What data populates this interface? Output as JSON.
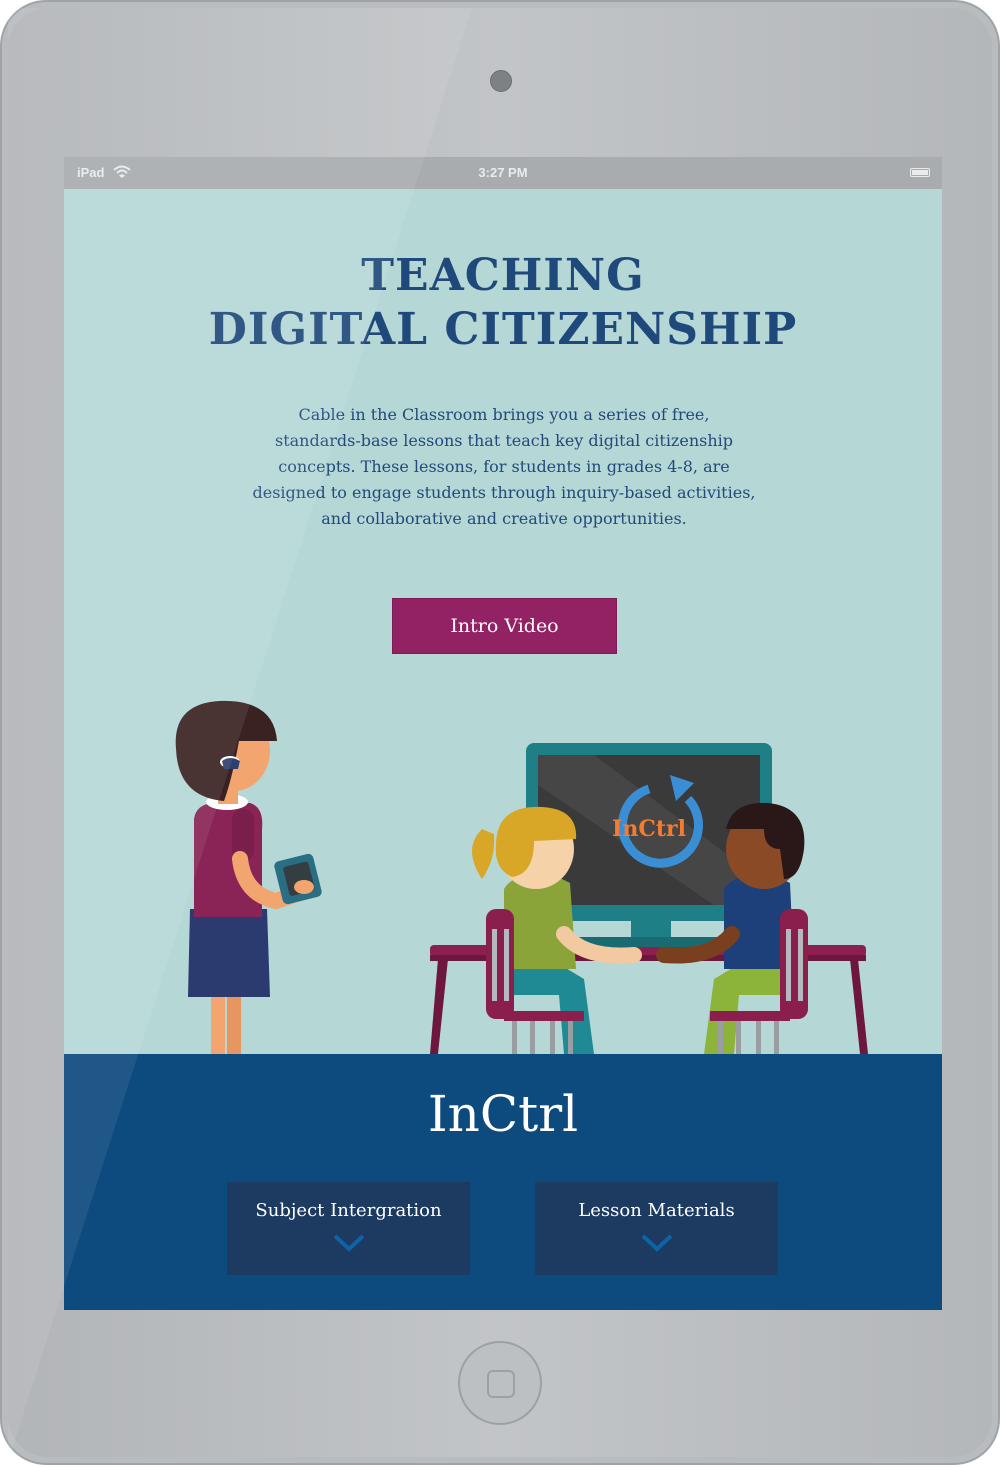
{
  "status_bar": {
    "device": "iPad",
    "time": "3:27 PM"
  },
  "hero": {
    "title_line1": "TEACHING",
    "title_line2": "DIGITAL CITIZENSHIP",
    "intro_lines": [
      "Cable in the Classroom brings you a series of free,",
      "standards-base lessons that teach key digital citizenship",
      "concepts. These lessons, for students in grades 4-8, are",
      "designed to engage  students through inquiry-based activities,",
      "and collaborative and creative opportunities."
    ],
    "video_button_label": "Intro Video"
  },
  "illustration": {
    "monitor_logo_text": "InCtrl"
  },
  "panel": {
    "brand_title": "InCtrl",
    "buttons": [
      {
        "label": "Subject Intergration"
      },
      {
        "label": "Lesson Materials"
      }
    ]
  },
  "colors": {
    "screen_bg": "#b5d8d6",
    "title": "#20497b",
    "button": "#932264",
    "panel": "#0d4a7e",
    "panel_button": "#1d3a60",
    "logo_orange": "#f47c30",
    "logo_blue": "#3a8fd4"
  }
}
